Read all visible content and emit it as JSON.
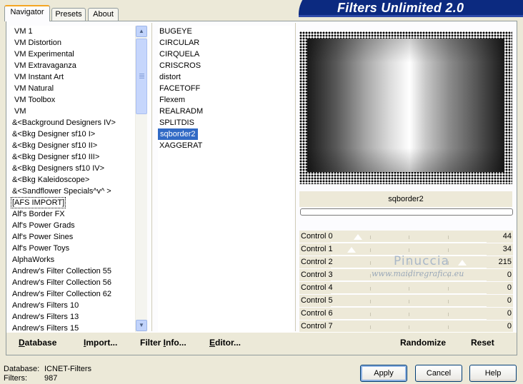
{
  "header": {
    "title": "Filters Unlimited 2.0"
  },
  "tabs": [
    {
      "label": "Navigator",
      "active": true
    },
    {
      "label": "Presets",
      "active": false
    },
    {
      "label": "About",
      "active": false
    }
  ],
  "categories": {
    "items": [
      "VM 1",
      "VM Distortion",
      "VM Experimental",
      "VM Extravaganza",
      "VM Instant Art",
      "VM Natural",
      "VM Toolbox",
      "VM",
      "&<Background Designers IV>",
      "&<Bkg Designer sf10 I>",
      "&<Bkg Designer sf10 II>",
      "&<Bkg Designer sf10 III>",
      "&<Bkg Designers sf10 IV>",
      "&<Bkg Kaleidoscope>",
      "&<Sandflower Specials^v^ >",
      "[AFS IMPORT]",
      "Alf's Border FX",
      "Alf's Power Grads",
      "Alf's Power Sines",
      "Alf's Power Toys",
      "AlphaWorks",
      "Andrew's Filter Collection 55",
      "Andrew's Filter Collection 56",
      "Andrew's Filter Collection 62",
      "Andrew's Filters 10",
      "Andrew's Filters 13",
      "Andrew's Filters 15"
    ],
    "selected": "[AFS IMPORT]"
  },
  "filters": {
    "items": [
      "BUGEYE",
      "CIRCULAR",
      "CIRQUELA",
      "CRISCROS",
      "distort",
      "FACETOFF",
      "Flexem",
      "REALRADM",
      "SPLITDIS",
      "sqborder2",
      "XAGGERAT"
    ],
    "selected": "sqborder2"
  },
  "preview": {
    "filter_name": "sqborder2"
  },
  "controls": [
    {
      "label": "Control 0",
      "value": "44"
    },
    {
      "label": "Control 1",
      "value": "34"
    },
    {
      "label": "Control 2",
      "value": "215"
    },
    {
      "label": "Control 3",
      "value": "0"
    },
    {
      "label": "Control 4",
      "value": "0"
    },
    {
      "label": "Control 5",
      "value": "0"
    },
    {
      "label": "Control 6",
      "value": "0"
    },
    {
      "label": "Control 7",
      "value": "0"
    }
  ],
  "watermark": {
    "line1": "Pinuccia",
    "line2": "www.maidiregrafica.eu"
  },
  "bottom_links": {
    "database": {
      "underlined": "D",
      "rest": "atabase"
    },
    "import": {
      "underlined": "I",
      "rest": "mport..."
    },
    "filter_info": {
      "before": "Filter ",
      "underlined": "I",
      "rest": "nfo..."
    },
    "editor": {
      "underlined": "E",
      "rest": "ditor..."
    }
  },
  "actions": {
    "randomize": "Randomize",
    "reset": "Reset"
  },
  "status": {
    "database_label": "Database:",
    "database_value": "ICNET-Filters",
    "filters_label": "Filters:",
    "filters_value": "987"
  },
  "buttons": {
    "apply": "Apply",
    "cancel": "Cancel",
    "help": "Help"
  }
}
